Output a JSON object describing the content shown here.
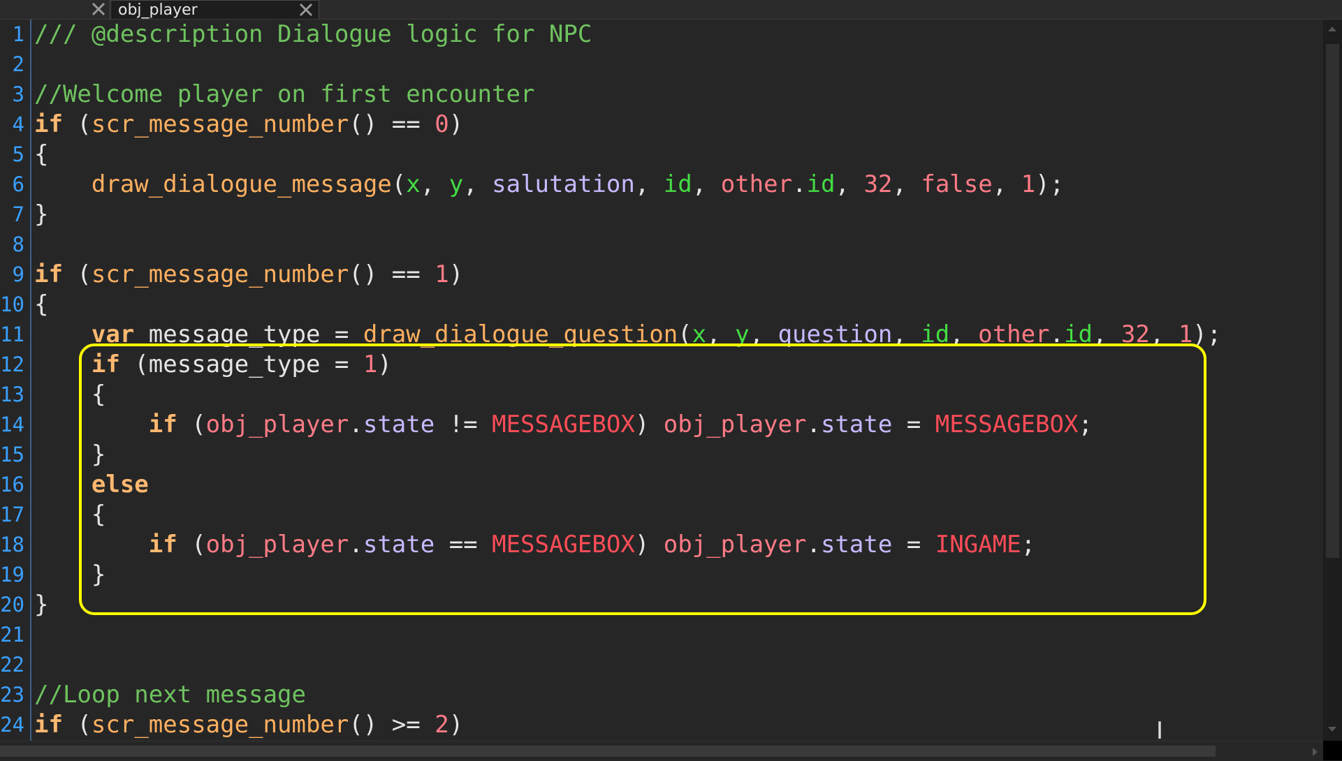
{
  "tabs": [
    {
      "label": ""
    },
    {
      "label": "obj_player"
    }
  ],
  "editor": {
    "line_numbers": [
      "1",
      "2",
      "3",
      "4",
      "5",
      "6",
      "7",
      "8",
      "9",
      "10",
      "11",
      "12",
      "13",
      "14",
      "15",
      "16",
      "17",
      "18",
      "19",
      "20",
      "21",
      "22",
      "23",
      "24"
    ],
    "lines": [
      "/// @description Dialogue logic for NPC",
      "",
      "//Welcome player on first encounter",
      "if (scr_message_number() == 0)",
      "{",
      "    draw_dialogue_message(x, y, salutation, id, other.id, 32, false, 1);",
      "}",
      "",
      "if (scr_message_number() == 1)",
      "{",
      "    var message_type = draw_dialogue_question(x, y, question, id, other.id, 32, 1);",
      "    if (message_type = 1)",
      "    {",
      "        if (obj_player.state != MESSAGEBOX) obj_player.state = MESSAGEBOX;",
      "    }",
      "    else",
      "    {",
      "        if (obj_player.state == MESSAGEBOX) obj_player.state = INGAME;",
      "    }",
      "}",
      "",
      "",
      "//Loop next message",
      "if (scr_message_number() >= 2)"
    ]
  },
  "colors": {
    "keyword": "#ffb870",
    "comment": "#6fc35f",
    "number": "#ff7b86",
    "constant": "#ff4d58",
    "highlight": "#ffff00",
    "line_number": "#3aa0ff"
  },
  "icons": {
    "tab_close": "close-icon",
    "cursor": "text-cursor-icon"
  }
}
